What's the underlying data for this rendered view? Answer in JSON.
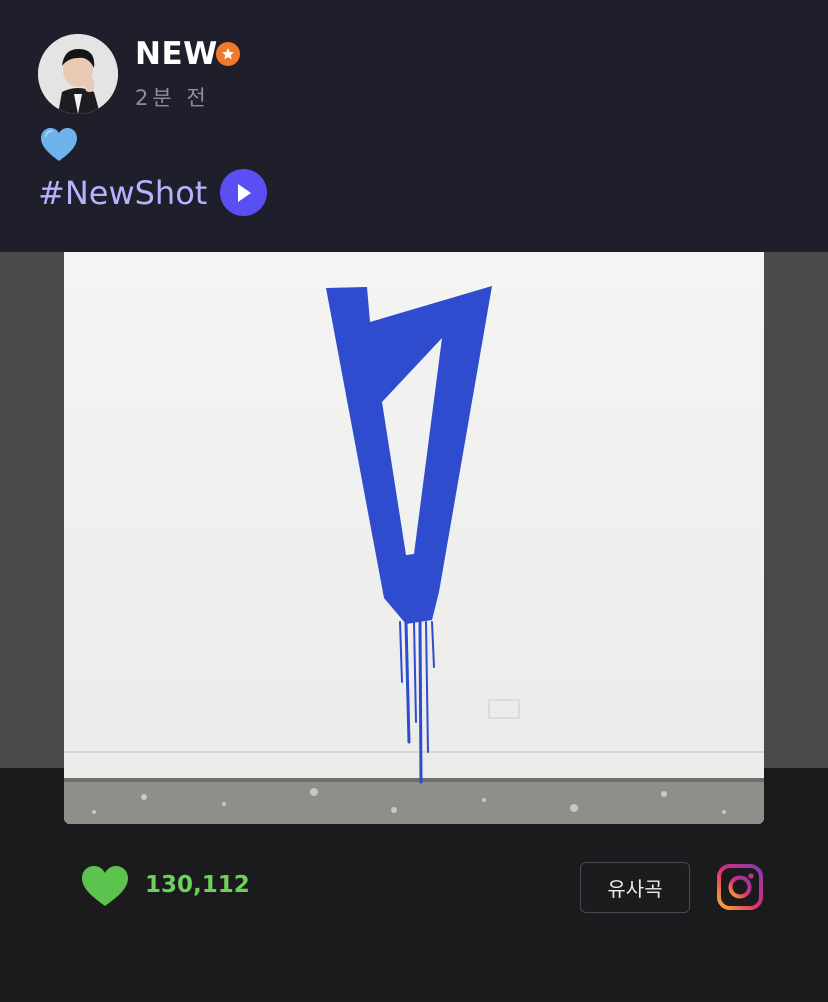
{
  "post": {
    "username": "NEW",
    "time_ago": "2분 전",
    "hashtag": "#NewShot"
  },
  "media": {
    "like_count": "130,112",
    "similar_label": "유사곡"
  },
  "colors": {
    "background": "#1f1f2c",
    "accent_play": "#5a4ff3",
    "hashtag": "#b7b1ff",
    "like_green": "#6ed15c",
    "badge_orange": "#f07a2a",
    "art_blue": "#2f4ccf"
  },
  "icons": [
    "verified-star-icon",
    "blue-heart-icon",
    "play-icon",
    "heart-icon",
    "instagram-icon"
  ]
}
